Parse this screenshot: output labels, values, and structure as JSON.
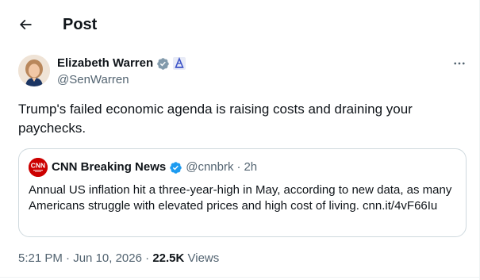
{
  "header": {
    "title": "Post",
    "back_icon": "arrow-left-icon"
  },
  "author": {
    "name": "Elizabeth Warren",
    "handle": "@SenWarren",
    "verified_badge": "verified-badge-icon",
    "affiliation_badge": "us-senate-badge-icon",
    "more_icon": "more-horizontal-icon"
  },
  "tweet": {
    "text": "Trump's failed economic agenda is raising costs and draining your paychecks."
  },
  "quote": {
    "logo": "CNN",
    "name": "CNN Breaking News",
    "handle": "@cnnbrk",
    "separator": "·",
    "time": "2h",
    "text": "Annual US inflation hit a three-year-high in May, according to new data, as many Americans struggle with elevated prices and high cost of living. cnn.it/4vF66Iu"
  },
  "meta": {
    "time": "5:21 PM",
    "sep1": "·",
    "date": "Jun 10, 2026",
    "sep2": "·",
    "views_count": "22.5K",
    "views_label": "Views"
  },
  "colors": {
    "text_primary": "#0f1419",
    "text_secondary": "#536471",
    "verified_blue": "#1d9bf0",
    "verified_gray": "#829aab",
    "cnn_red": "#cc0000",
    "border": "#cfd9de"
  }
}
